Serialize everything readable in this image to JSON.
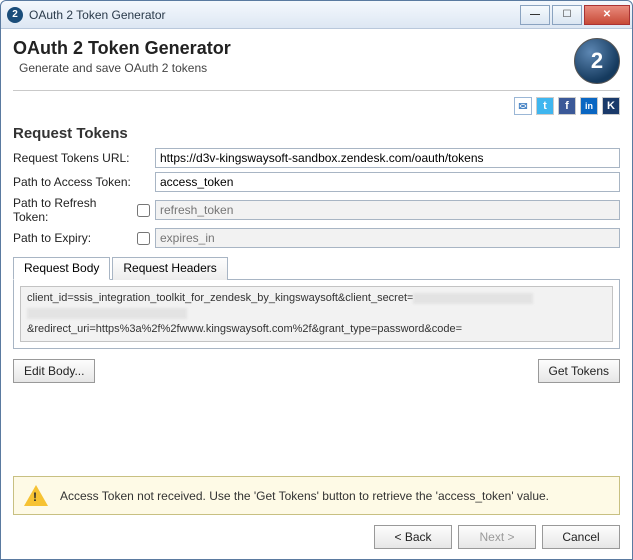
{
  "titlebar": {
    "title": "OAuth 2 Token Generator",
    "icon_text": "2"
  },
  "header": {
    "title": "OAuth 2 Token Generator",
    "subtitle": "Generate and save OAuth 2 tokens",
    "logo_text": "2"
  },
  "social": {
    "email": "✉",
    "twitter": "t",
    "facebook": "f",
    "linkedin": "in",
    "k": "K",
    "colors": {
      "email": "#4d88c7",
      "twitter": "#3fb6ef",
      "facebook": "#3b5998",
      "linkedin": "#0a66c2",
      "k": "#1a3a6a"
    }
  },
  "section_title": "Request Tokens",
  "fields": {
    "url_label": "Request Tokens URL:",
    "url_value": "https://d3v-kingswaysoft-sandbox.zendesk.com/oauth/tokens",
    "access_label": "Path to Access Token:",
    "access_value": "access_token",
    "refresh_label": "Path to Refresh Token:",
    "refresh_placeholder": "refresh_token",
    "refresh_checked": false,
    "expiry_label": "Path to Expiry:",
    "expiry_placeholder": "expires_in",
    "expiry_checked": false
  },
  "tabs": {
    "body": "Request Body",
    "headers": "Request Headers",
    "active": "body"
  },
  "body_text": {
    "part1": "client_id=ssis_integration_toolkit_for_zendesk_by_kingswaysoft&client_secret=",
    "part2": "&redirect_uri=https%3a%2f%2fwww.kingswaysoft.com%2f&grant_type=password&code="
  },
  "buttons": {
    "edit_body": "Edit Body...",
    "get_tokens": "Get Tokens",
    "back": "< Back",
    "next": "Next >",
    "cancel": "Cancel"
  },
  "warning_text": "Access Token not received. Use the 'Get Tokens' button to retrieve the 'access_token' value."
}
